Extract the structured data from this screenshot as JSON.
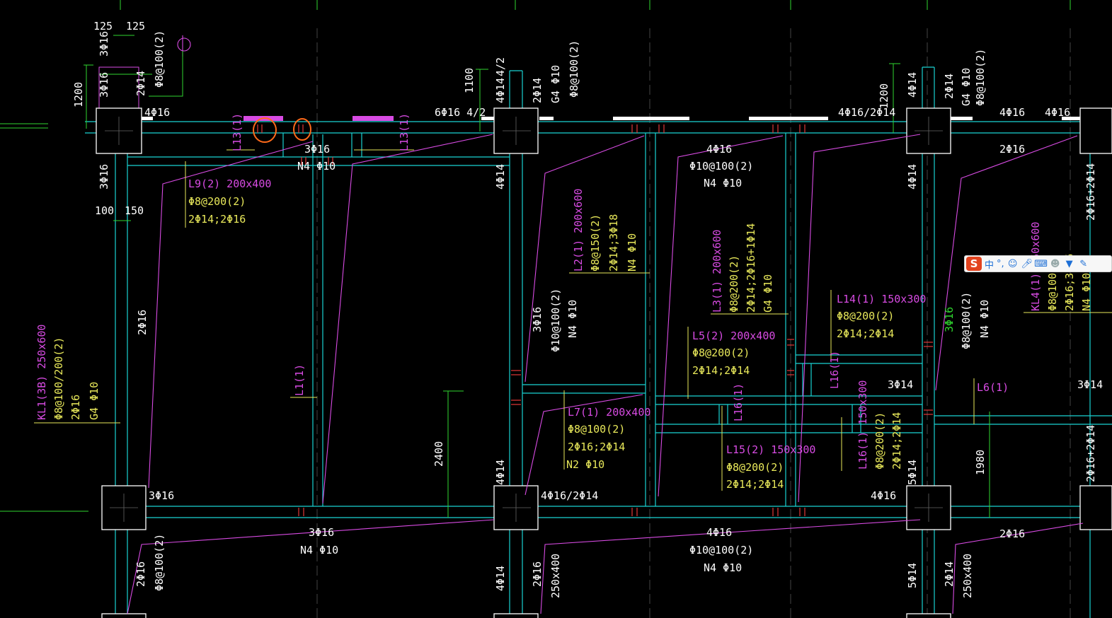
{
  "drawing": {
    "colors": {
      "background": "#000000",
      "beam_line": "#19d3d3",
      "column_outline": "#ffffff",
      "annotation_yellow": "#e8e85a",
      "annotation_magenta": "#d84be3",
      "dimension_green": "#2fd62f",
      "rebar_red": "#e23a3a",
      "markup_orange": "#ff6a1a"
    },
    "beams_top": [
      "4Φ16",
      "6Φ16 4/2",
      "4Φ16/2Φ14",
      "4Φ16",
      "4Φ16",
      "3Φ16",
      "4Φ16",
      "2Φ16"
    ],
    "beams_mid": [
      "3Φ16",
      "4Φ16/2Φ14",
      "4Φ16",
      "3Φ14",
      "3Φ14"
    ],
    "beams_bottom": [
      "3Φ16",
      "N4 Φ10",
      "4Φ16",
      "Φ10@100(2)",
      "N4 Φ10",
      "2Φ16"
    ],
    "stirrups_row1": [
      "3Φ16",
      "N4 Φ10",
      "4Φ16",
      "Φ10@100(2)",
      "N4 Φ10"
    ],
    "left_col": [
      "3Φ16",
      "3Φ16",
      "2Φ16",
      "2Φ16",
      "Φ8@100(2)"
    ],
    "top_col_left": [
      "3Φ16",
      "3Φ16",
      "2Φ14",
      "Φ8@100(2)",
      "Φ8@100(2)"
    ],
    "top_mid_col": [
      "4Φ14",
      "2Φ14",
      "G4 Φ10",
      "Φ8@100(2)",
      "4/2"
    ],
    "top_right_col": [
      "4Φ14",
      "2Φ14",
      "G4 Φ10",
      "Φ8@100(2)"
    ],
    "vertical_mid": [
      "4Φ14",
      "4Φ14",
      "4Φ14",
      "2Φ16",
      "250x400",
      "5Φ14",
      "2Φ14",
      "250x400",
      "4Φ14",
      "5Φ14"
    ],
    "right_edge": [
      "2Φ16+2Φ14",
      "2Φ16+2Φ14",
      "3Φ14"
    ],
    "kl1": {
      "t1": "KL1(3B) 250x600",
      "t2": "Φ8@100/200(2)",
      "t3": "2Φ16",
      "t4": "G4 Φ10"
    },
    "l9": {
      "t1": "L9(2) 200x400",
      "t2": "Φ8@200(2)",
      "t3": "2Φ14;2Φ16"
    },
    "l2": {
      "t1": "L2(1) 200x600",
      "t2": "Φ8@150(2)",
      "t3": "2Φ14;3Φ18",
      "t4": "N4 Φ10"
    },
    "l3": {
      "t1": "L3(1) 200x600",
      "t2": "Φ8@200(2)",
      "t3": "2Φ14;2Φ16+1Φ14",
      "t4": "G4 Φ10"
    },
    "l5": {
      "t1": "L5(2) 200x400",
      "t2": "Φ8@200(2)",
      "t3": "2Φ14;2Φ14"
    },
    "l7": {
      "t1": "L7(1) 200x400",
      "t2": "Φ8@100(2)",
      "t3": "2Φ16;2Φ14",
      "t4": "N2 Φ10"
    },
    "l14": {
      "t1": "L14(1) 150x300",
      "t2": "Φ8@200(2)",
      "t3": "2Φ14;2Φ14"
    },
    "l15": {
      "t1": "L15(2) 150x300",
      "t2": "Φ8@200(2)",
      "t3": "2Φ14;2Φ14"
    },
    "l16": {
      "t1": "L16(1) 150x300",
      "t2": "Φ8@200(2)",
      "t3": "2Φ14;2Φ14",
      "t4": "L16(1)",
      "t5": "L16(1)"
    },
    "l4": {
      "t1": "KL4(1) 250x600",
      "t2": "Φ8@100(2)",
      "t3": "2Φ16;3Φ16",
      "t4": "N4 Φ10"
    },
    "l13": {
      "a": "L13(1)",
      "b": "L13(1)"
    },
    "l1": "L1(1)",
    "l6": "L6(1)",
    "col_stirrups": [
      "Φ10@100(2)",
      "N4 Φ10",
      "Φ8@100(2)",
      "N4 Φ10",
      "3Φ16",
      "3Φ16"
    ],
    "dims": {
      "d125a": "125",
      "d125b": "125",
      "d1200a": "1200",
      "d1100": "1100",
      "d1200b": "1200",
      "d100": "100",
      "d150": "150",
      "d2400": "2400",
      "d1980": "1980"
    }
  },
  "ime_toolbar": {
    "logo": "S",
    "lang": "中",
    "punct": "°,",
    "icons": [
      "emoji-icon",
      "microphone-icon",
      "keyboard-icon",
      "user-icon",
      "shirt-icon",
      "wrench-icon"
    ]
  }
}
